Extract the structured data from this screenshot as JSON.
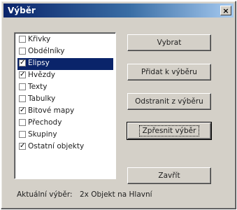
{
  "window": {
    "title": "Výběr",
    "close_glyph": "×"
  },
  "list": {
    "items": [
      {
        "label": "Křivky",
        "checked": false,
        "selected": false
      },
      {
        "label": "Obdélníky",
        "checked": false,
        "selected": false
      },
      {
        "label": "Elipsy",
        "checked": true,
        "selected": true
      },
      {
        "label": "Hvězdy",
        "checked": true,
        "selected": false
      },
      {
        "label": "Texty",
        "checked": false,
        "selected": false
      },
      {
        "label": "Tabulky",
        "checked": false,
        "selected": false
      },
      {
        "label": "Bitové mapy",
        "checked": true,
        "selected": false
      },
      {
        "label": "Přechody",
        "checked": false,
        "selected": false
      },
      {
        "label": "Skupiny",
        "checked": false,
        "selected": false
      },
      {
        "label": "Ostatní objekty",
        "checked": true,
        "selected": false
      }
    ]
  },
  "buttons": {
    "select": "Vybrat",
    "add": "Přidat k výběru",
    "remove": "Odstranit z výběru",
    "refine": "Zpřesnit výběr",
    "close": "Zavřít"
  },
  "status": {
    "label": "Aktuální výběr:",
    "value": "2x Objekt na Hlavní"
  }
}
